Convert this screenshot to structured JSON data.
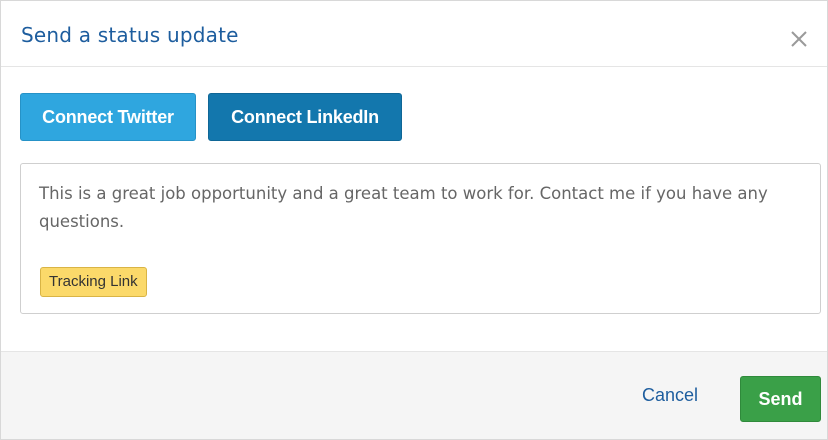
{
  "dialog": {
    "title": "Send a status update",
    "close_icon": "close-icon"
  },
  "connect": {
    "twitter_label": "Connect Twitter",
    "linkedin_label": "Connect LinkedIn"
  },
  "composer": {
    "text": "This is a great job opportunity and a great team to work for. Contact me if you have any questions.",
    "tag_label": "Tracking Link"
  },
  "footer": {
    "cancel_label": "Cancel",
    "send_label": "Send"
  },
  "colors": {
    "title": "#1d5d9e",
    "twitter": "#2fa6df",
    "linkedin": "#1377ad",
    "tag": "#fbd96a",
    "send": "#3aa048",
    "footer_bg": "#f5f5f5"
  }
}
